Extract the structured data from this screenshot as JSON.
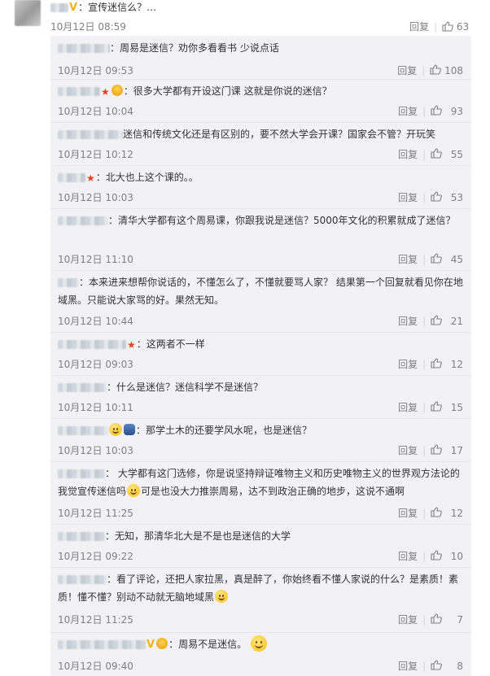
{
  "parent": {
    "text": "：宣传迷信么？…",
    "date": "10月12日 08:59",
    "reply_label": "回复",
    "likes": "63"
  },
  "replies": [
    {
      "text": "：周易是迷信？劝你多看看书 少说点话",
      "date": "10月12日 09:53",
      "reply_label": "回复",
      "likes": "108"
    },
    {
      "text": "：很多大学都有开设这门课 这就是你说的迷信？",
      "date": "10月12日 10:04",
      "reply_label": "回复",
      "likes": "93"
    },
    {
      "text": "迷信和传统文化还是有区别的，要不然大学会开课？国家会不管？开玩笑",
      "date": "10月12日 10:12",
      "reply_label": "回复",
      "likes": "55"
    },
    {
      "text": "：北大也上这个课的。。",
      "date": "10月12日 10:03",
      "reply_label": "回复",
      "likes": "53"
    },
    {
      "text": "：清华大学都有这个周易课，你跟我说是迷信？5000年文化的积累就成了迷信？",
      "date": "10月12日 11:10",
      "reply_label": "回复",
      "likes": "45"
    },
    {
      "text": "：本来进来想帮你说话的，不懂怎么了，不懂就要骂人家？ 结果第一个回复就看见你在地域黑。只能说大家骂的好。果然无知。",
      "date": "10月12日 10:44",
      "reply_label": "回复",
      "likes": "21"
    },
    {
      "text": "：这两者不一样",
      "date": "10月12日 09:03",
      "reply_label": "回复",
      "likes": "12"
    },
    {
      "text": "：什么是迷信？迷信科学不是迷信？",
      "date": "10月12日 10:11",
      "reply_label": "回复",
      "likes": "15"
    },
    {
      "text": "：那学土木的还要学风水呢，也是迷信？",
      "date": "10月12日 10:03",
      "reply_label": "回复",
      "likes": "17"
    },
    {
      "text": "： 大学都有这门选修，你是说坚持辩证唯物主义和历史唯物主义的世界观方法论的我觉宣传迷信吗",
      "text2": "可是也没大力推崇周易，达不到政治正确的地步，这说不通啊",
      "date": "10月12日 11:25",
      "reply_label": "回复",
      "likes": "12"
    },
    {
      "text": "：无知，那清华北大是不是也是迷信的大学",
      "date": "10月12日 09:22",
      "reply_label": "回复",
      "likes": "10"
    },
    {
      "text": "：看了评论，还把人家拉黑，真是醉了，你始终看不懂人家说的什么？是素质！素质！懂不懂？别动不动就无脑地域黑",
      "date": "10月12日 11:25",
      "reply_label": "回复",
      "likes": "7"
    },
    {
      "text": "：周易不是迷信。",
      "date": "10月12日 09:40",
      "reply_label": "回复",
      "likes": "8"
    }
  ],
  "icons": {
    "like": "thumbs-up-icon",
    "verified": "v-badge-icon",
    "star": "star-icon",
    "emoji": "emoji-icon"
  },
  "colors": {
    "panel_bg": "#f2f2f5",
    "meta": "#808080",
    "text": "#333333",
    "star": "#e8401e",
    "vbadge": "#f3b21a"
  }
}
